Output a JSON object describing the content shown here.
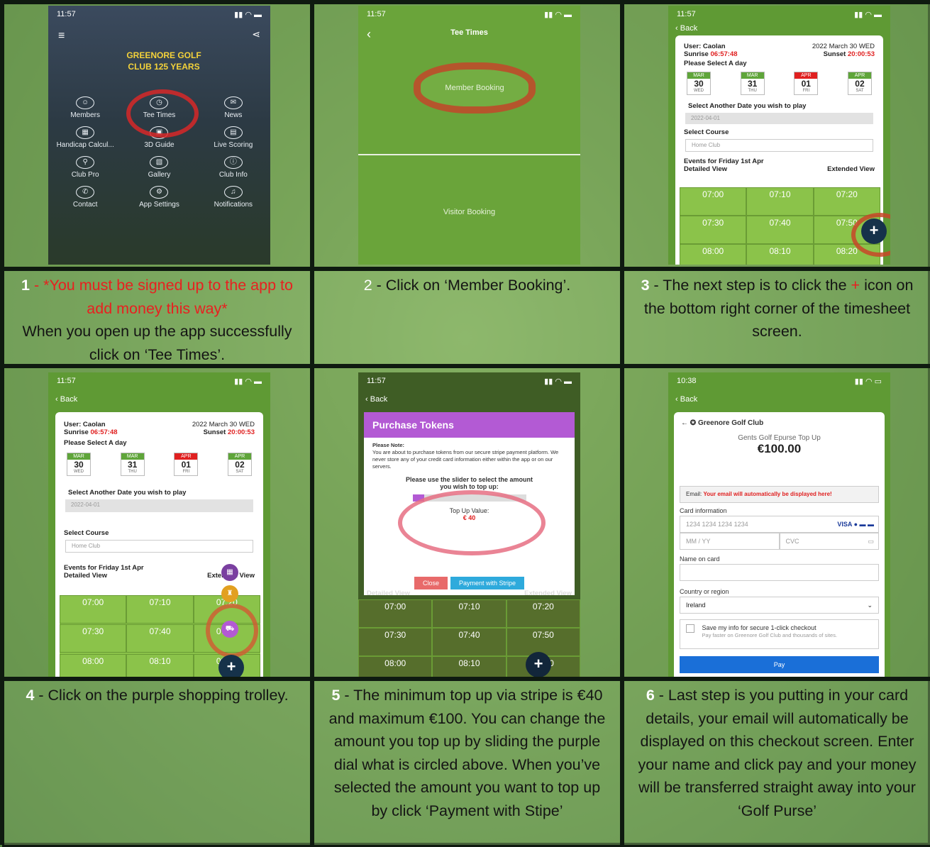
{
  "steps": [
    {
      "number": "1",
      "caption_red": " - *You must be signed up to the app to add money this way*",
      "caption": "When you open up the app successfully click on ‘Tee Times’.",
      "screen": {
        "time": "11:57",
        "logo_text": "GREENORE GOLF CLUB 125 YEARS",
        "menu": [
          "Members",
          "Tee Times",
          "News",
          "Handicap Calcul...",
          "3D Guide",
          "Live Scoring",
          "Club Pro",
          "Gallery",
          "Club Info",
          "Contact",
          "App Settings",
          "Notifications"
        ]
      }
    },
    {
      "number": "2",
      "caption": " - Click on ‘Member Booking’.",
      "screen": {
        "time": "11:57",
        "title": "Tee Times",
        "member_booking": "Member Booking",
        "visitor_booking": "Visitor Booking"
      }
    },
    {
      "number": "3",
      "caption_pre": " - The next step is to click the ",
      "caption_plus": "+",
      "caption_post": " icon on the bottom right corner of the timesheet screen.",
      "screen": {
        "time": "11:57",
        "back": "Back"
      }
    },
    {
      "number": "4",
      "caption": " - Click on the purple shopping trolley.",
      "screen": {
        "time": "11:57",
        "back": "Back"
      }
    },
    {
      "number": "5",
      "caption": " - The minimum top up via stripe is €40 and maximum €100. You can change the amount you top up by sliding the purple dial what is circled above. When you’ve selected the amount you want to top up by click ‘Payment with Stipe’",
      "screen": {
        "time": "11:57",
        "back": "Back",
        "modal_title": "Purchase Tokens",
        "note_title": "Please Note:",
        "note": "You are about to purchase tokens from our secure stripe payment platform. We never store any of your credit card information either within the app or on our servers.",
        "slider_label": "Please use the slider to select the amount you wish to top up:",
        "slider_value": 0.0,
        "top_up_label": "Top Up Value:",
        "top_up_value": "€ 40",
        "close": "Close",
        "pay": "Payment with Stripe",
        "detailed": "Detailed View",
        "extended": "Extended View"
      }
    },
    {
      "number": "6",
      "caption": " - Last step is you putting in your card details, your email will automatically be displayed on this checkout screen. Enter your name and click pay and your money will be transferred straight away into your ‘Golf Purse’",
      "screen": {
        "time": "10:38",
        "back": "Back",
        "club": "Greenore Golf Club",
        "product": "Gents Golf Epurse Top Up",
        "amount": "€100.00",
        "email_label": "Email:",
        "email_note": "Your email will automatically be displayed here!",
        "card_info": "Card information",
        "card_placeholder": "1234 1234 1234 1234",
        "exp_placeholder": "MM / YY",
        "cvc_placeholder": "CVC",
        "name_label": "Name on card",
        "country_label": "Country or region",
        "country": "Ireland",
        "save_title": "Save my info for secure 1-click checkout",
        "save_sub": "Pay faster on Greenore Golf Club and thousands of sites.",
        "pay": "Pay"
      }
    }
  ],
  "booking": {
    "user": "User: Caolan",
    "date": "2022 March 30 WED",
    "sunrise_label": "Sunrise",
    "sunrise": "06:57:48",
    "sunset_label": "Sunset",
    "sunset": "20:00:53",
    "select_day": "Please Select A day",
    "days": [
      {
        "m": "MAR",
        "d": "30",
        "w": "WED",
        "color": "#5fa53a"
      },
      {
        "m": "MAR",
        "d": "31",
        "w": "THU",
        "color": "#5fa53a"
      },
      {
        "m": "APR",
        "d": "01",
        "w": "FRI",
        "color": "#e02020"
      },
      {
        "m": "APR",
        "d": "02",
        "w": "SAT",
        "color": "#5fa53a"
      }
    ],
    "another_date": "Select Another Date you wish to play",
    "date_value": "2022-04-01",
    "select_course": "Select Course",
    "course": "Home Club",
    "events": "Events for Friday 1st Apr",
    "detailed": "Detailed View",
    "extended": "Extended View",
    "times": [
      "07:00",
      "07:10",
      "07:20",
      "07:30",
      "07:40",
      "07:50",
      "08:00",
      "08:10",
      "08:20"
    ]
  }
}
